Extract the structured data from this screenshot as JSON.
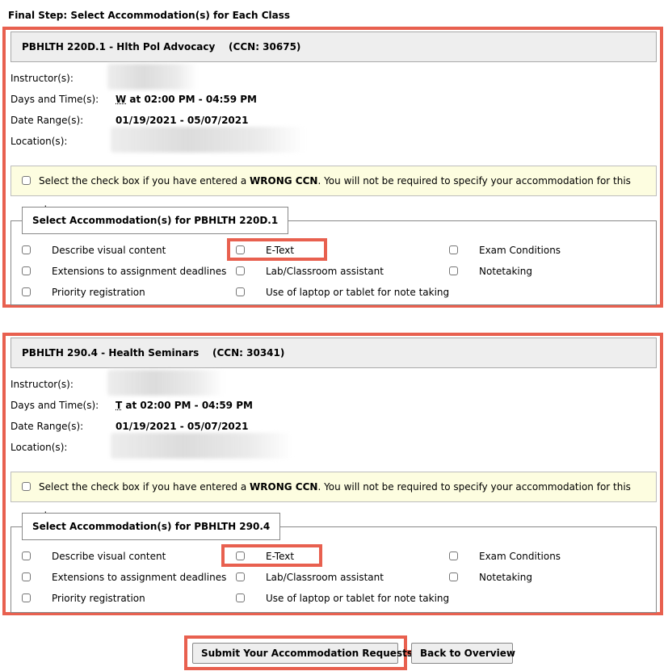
{
  "page_title": "Final Step: Select Accommodation(s) for Each Class",
  "labels": {
    "instructor": "Instructor(s):",
    "days_time": "Days and Time(s):",
    "date_range": "Date Range(s):",
    "location": "Location(s):"
  },
  "wrong_ccn": {
    "prefix": "Select the check box if you have entered a ",
    "emphasis": "WRONG CCN",
    "suffix": ". You will not be required to specify your accommodation for this class."
  },
  "classes": [
    {
      "header": "PBHLTH 220D.1 - Hlth Pol Advocacy    (CCN: 30675)",
      "day": "W",
      "time": " at 02:00 PM - 04:59 PM",
      "date_range": "01/19/2021 - 05/07/2021",
      "legend": "Select Accommodation(s) for PBHLTH 220D.1"
    },
    {
      "header": "PBHLTH 290.4 - Health Seminars    (CCN: 30341)",
      "day": "T",
      "time": " at 02:00 PM - 04:59 PM",
      "date_range": "01/19/2021 - 05/07/2021",
      "legend": "Select Accommodation(s) for PBHLTH 290.4"
    }
  ],
  "accommodations": [
    "Describe visual content",
    "E-Text",
    "Exam Conditions",
    "Extensions to assignment deadlines",
    "Lab/Classroom assistant",
    "Notetaking",
    "Priority registration",
    "Use of laptop or tablet for note taking"
  ],
  "buttons": {
    "submit": "Submit Your Accommodation Requests",
    "back": "Back to Overview"
  },
  "colors": {
    "highlight": "#e8604f",
    "header_bg": "#eeeeee",
    "notice_bg": "#fdfde0"
  }
}
